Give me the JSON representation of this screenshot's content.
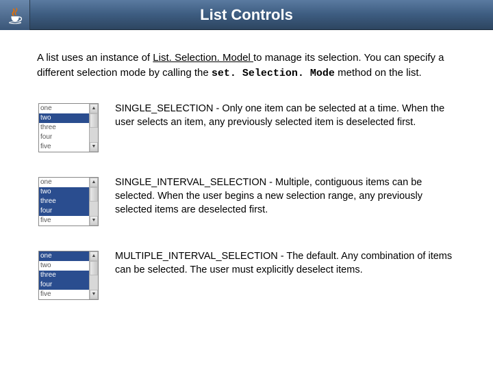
{
  "header": {
    "title": "List Controls"
  },
  "intro": {
    "p1": "A list uses an instance of ",
    "link": "List. Selection. Model ",
    "p2": " to manage its selection. You can specify a different selection mode by calling the ",
    "code": "set. Selection. Mode",
    "p3": " method on the list."
  },
  "list_items": [
    "one",
    "two",
    "three",
    "four",
    "five"
  ],
  "modes": [
    {
      "desc": "SINGLE_SELECTION - Only one item can be selected at a time. When the user selects an item, any previously selected item is deselected first."
    },
    {
      "desc": "SINGLE_INTERVAL_SELECTION - Multiple, contiguous items can be selected. When the user begins a new selection range, any previously selected items are deselected first."
    },
    {
      "desc": "MULTIPLE_INTERVAL_SELECTION - The default. Any combination of items can be selected. The user must explicitly deselect items."
    }
  ]
}
